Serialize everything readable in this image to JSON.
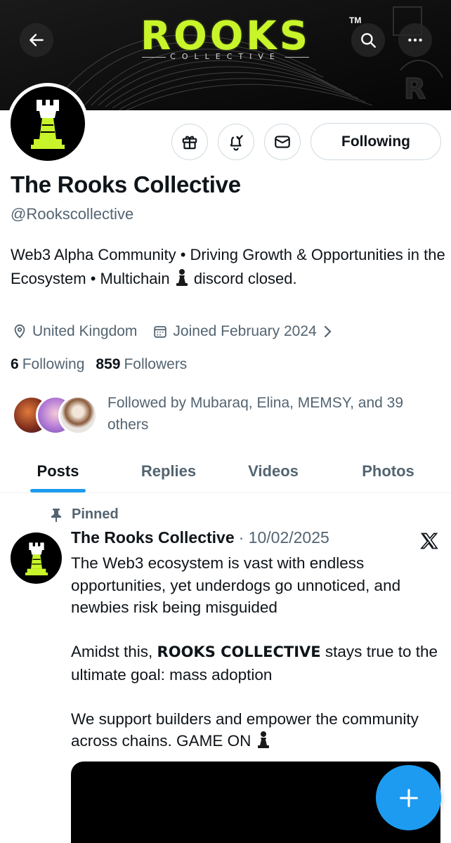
{
  "banner": {
    "brand_word": "ROOKS",
    "brand_tm": "TM",
    "brand_sub": "COLLECTIVE",
    "accent_color": "#c8f52a"
  },
  "header_buttons": {
    "back": "back-arrow-icon",
    "search": "search-icon",
    "more": "more-horizontal-icon"
  },
  "profile": {
    "name": "The Rooks Collective",
    "handle": "@Rookscollective",
    "bio_1": "Web3 Alpha Community • Driving Growth & Opportunities in the Ecosystem • Multichain",
    "bio_2": "discord closed.",
    "location": "United Kingdom",
    "joined": "Joined February 2024",
    "following_count": "6",
    "following_label": "Following",
    "followers_count": "859",
    "followers_label": "Followers",
    "followed_by": "Followed by Mubaraq, Elina, MEMSY, and 39 others",
    "follow_button": "Following"
  },
  "actions": [
    "gift-icon",
    "notification-bell-icon",
    "message-envelope-icon"
  ],
  "tabs": [
    {
      "label": "Posts",
      "active": true
    },
    {
      "label": "Replies",
      "active": false
    },
    {
      "label": "Videos",
      "active": false
    },
    {
      "label": "Photos",
      "active": false
    }
  ],
  "post": {
    "pinned_label": "Pinned",
    "author": "The Rooks Collective",
    "date": "· 10/02/2025",
    "para1": "The Web3 ecosystem is vast with endless opportunities, yet underdogs go unnoticed, and newbies risk being misguided",
    "para2_a": "Amidst this,",
    "para2_bold": "ROOKS COLLECTIVE",
    "para2_b": "stays true to the ultimate goal: mass adoption",
    "para3": "We support builders and empower the community across chains. GAME ON"
  },
  "colors": {
    "accent_blue": "#1d9bf0",
    "muted": "#536471",
    "text": "#0f1419"
  }
}
